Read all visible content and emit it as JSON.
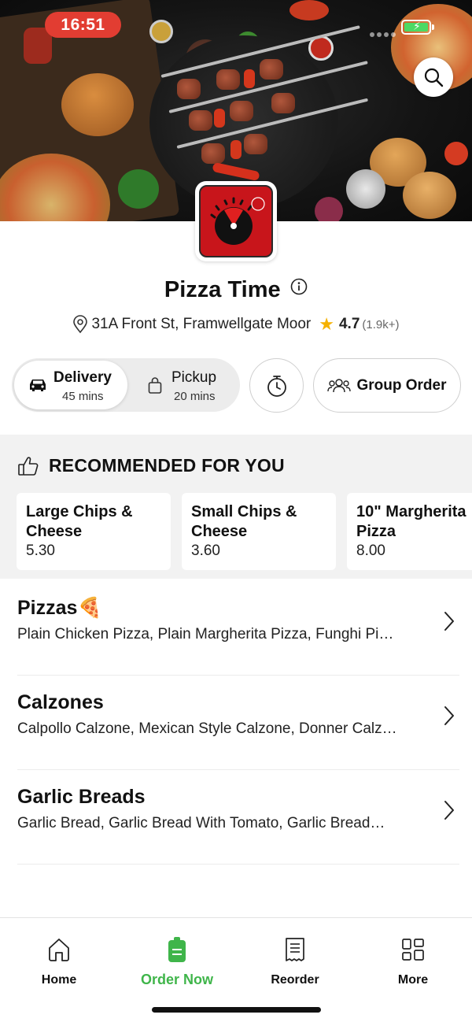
{
  "status_bar": {
    "time": "16:51"
  },
  "restaurant": {
    "name": "Pizza Time",
    "address": "31A Front St, Framwellgate Moor",
    "rating": "4.7",
    "rating_count": "(1.9k+)"
  },
  "modes": {
    "delivery": {
      "label": "Delivery",
      "time": "45 mins",
      "selected": true
    },
    "pickup": {
      "label": "Pickup",
      "time": "20 mins",
      "selected": false
    }
  },
  "group_order_label": "Group Order",
  "recommended": {
    "title": "RECOMMENDED FOR YOU",
    "items": [
      {
        "name_line1": "Large Chips &",
        "name_line2": "Cheese",
        "price": "5.30"
      },
      {
        "name_line1": "Small Chips &",
        "name_line2": "Cheese",
        "price": "3.60"
      },
      {
        "name_line1": "10\" Margherita",
        "name_line2": "Pizza",
        "price": "8.00"
      }
    ]
  },
  "categories": [
    {
      "name": "Pizzas",
      "emoji": "🍕",
      "description": "Plain Chicken Pizza, Plain Margherita Pizza, Funghi Pi…"
    },
    {
      "name": "Calzones",
      "emoji": "",
      "description": "Calpollo Calzone, Mexican Style Calzone, Donner Calz…"
    },
    {
      "name": "Garlic Breads",
      "emoji": "",
      "description": "Garlic Bread, Garlic Bread With Tomato, Garlic Bread…"
    }
  ],
  "bottom_nav": [
    {
      "label": "Home",
      "icon": "home-icon",
      "active": false
    },
    {
      "label": "Order Now",
      "icon": "order-icon",
      "active": true
    },
    {
      "label": "Reorder",
      "icon": "receipt-icon",
      "active": false
    },
    {
      "label": "More",
      "icon": "grid-icon",
      "active": false
    }
  ],
  "colors": {
    "accent_green": "#3fb54a",
    "status_red": "#e23d32",
    "logo_red": "#c8151b",
    "star": "#f5b100"
  }
}
